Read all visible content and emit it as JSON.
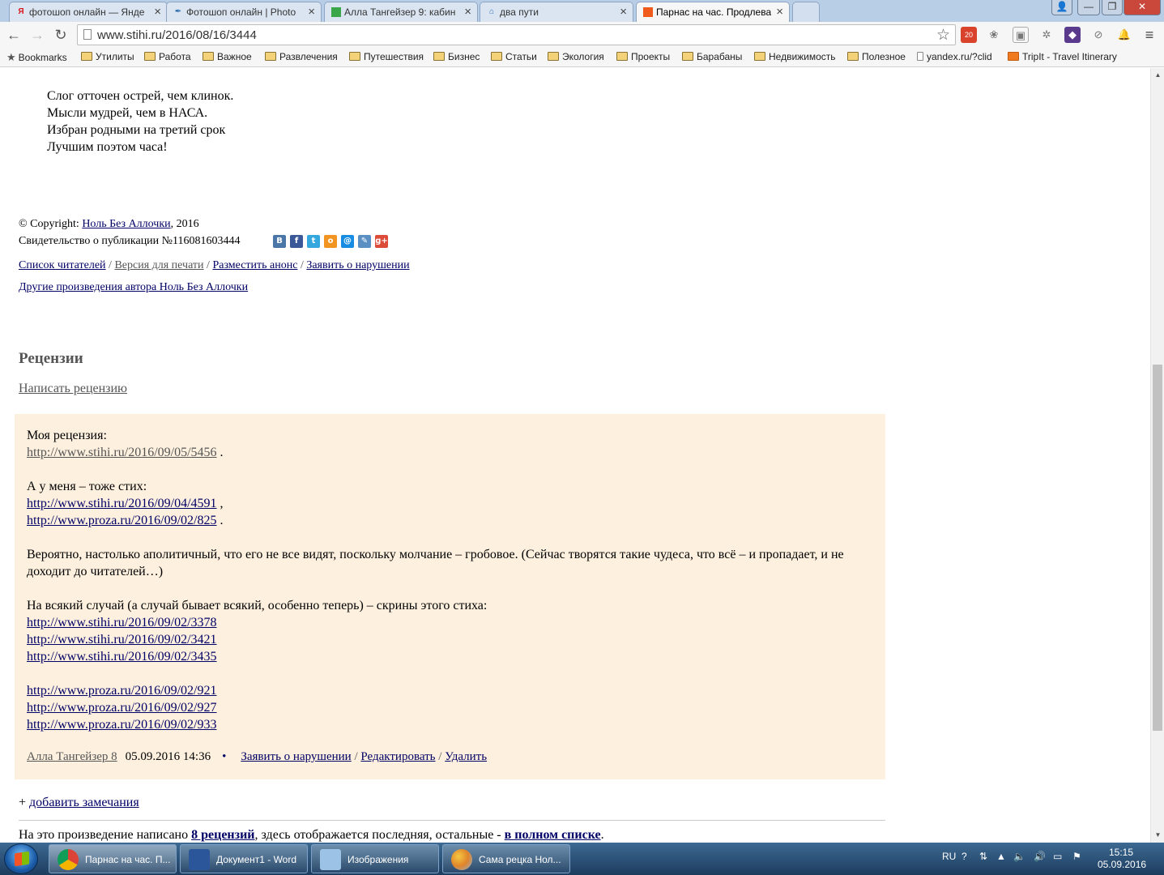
{
  "browser": {
    "tabs": [
      {
        "title": "фотошоп онлайн — Янде",
        "icon": "yandex-icon",
        "color": "#d9141b",
        "active": false
      },
      {
        "title": "Фотошоп онлайн | Photo",
        "icon": "feather-icon",
        "color": "#2b6cb0",
        "active": false
      },
      {
        "title": "Алла Тангейзер 9: кабин",
        "icon": "square-icon",
        "color": "#3aa64a",
        "active": false
      },
      {
        "title": "два пути",
        "icon": "home-icon",
        "color": "#3070b8",
        "active": false
      },
      {
        "title": "Парнас на час. Продлева",
        "icon": "stihi-icon",
        "color": "#f05a1a",
        "active": true
      }
    ],
    "url": "www.stihi.ru/2016/08/16/3444",
    "bookmarks": [
      {
        "label": "Bookmarks",
        "kind": "star"
      },
      {
        "label": "Утилиты",
        "kind": "folder"
      },
      {
        "label": "Работа",
        "kind": "folder"
      },
      {
        "label": "Важное",
        "kind": "folder"
      },
      {
        "label": "Развлечения",
        "kind": "folder"
      },
      {
        "label": "Путешествия",
        "kind": "folder"
      },
      {
        "label": "Бизнес",
        "kind": "folder"
      },
      {
        "label": "Статьи",
        "kind": "folder"
      },
      {
        "label": "Экология",
        "kind": "folder"
      },
      {
        "label": "Проекты",
        "kind": "folder"
      },
      {
        "label": "Барабаны",
        "kind": "folder"
      },
      {
        "label": "Недвижимость",
        "kind": "folder"
      },
      {
        "label": "Полезное",
        "kind": "folder"
      },
      {
        "label": "yandex.ru/?clid",
        "kind": "page"
      },
      {
        "label": "TripIt - Travel Itinerary",
        "kind": "tripit"
      }
    ],
    "extension_badge": "20"
  },
  "poem": {
    "lines": [
      "Слог отточен острей, чем клинок.",
      "Мысли мудрей, чем в НАСА.",
      "Избран родными на третий срок",
      "Лучшим поэтом часа!"
    ]
  },
  "copyright": {
    "prefix": "© Copyright: ",
    "author": "Ноль Без Аллочки",
    "year": ", 2016",
    "certificate": "Свидетельство о публикации №116081603444"
  },
  "share_icons": [
    {
      "name": "vk-share-icon",
      "glyph": "B",
      "color": "#4a76a8"
    },
    {
      "name": "facebook-share-icon",
      "glyph": "f",
      "color": "#3b5998"
    },
    {
      "name": "twitter-share-icon",
      "glyph": "t",
      "color": "#35a7df"
    },
    {
      "name": "odnoklassniki-share-icon",
      "glyph": "o",
      "color": "#f19421"
    },
    {
      "name": "mailru-share-icon",
      "glyph": "@",
      "color": "#168de2"
    },
    {
      "name": "livejournal-share-icon",
      "glyph": "✎",
      "color": "#5a8fc4"
    },
    {
      "name": "googleplus-share-icon",
      "glyph": "g+",
      "color": "#dd4b39"
    }
  ],
  "actions": {
    "readers": "Список читателей",
    "print": "Версия для печати",
    "announce": "Разместить анонс",
    "report": "Заявить о нарушении",
    "other_works": "Другие произведения автора Ноль Без Аллочки"
  },
  "reviews": {
    "heading": "Рецензии",
    "write": "Написать рецензию",
    "review": {
      "intro": "Моя рецензия:",
      "my_link": "http://www.stihi.ru/2016/09/05/5456",
      "also": "А у меня – тоже стих:",
      "also_links": [
        "http://www.stihi.ru/2016/09/04/4591",
        "http://www.proza.ru/2016/09/02/825"
      ],
      "text": "Вероятно, настолько аполитичный, что его не все видят, поскольку молчание – гробовое. (Сейчас творятся такие чудеса, что всё – и пропадает, и не доходит до читателей…)",
      "screens_intro": "На всякий случай (а случай бывает всякий, особенно теперь) – скрины этого стиха:",
      "stihi_screens": [
        "http://www.stihi.ru/2016/09/02/3378",
        "http://www.stihi.ru/2016/09/02/3421",
        "http://www.stihi.ru/2016/09/02/3435"
      ],
      "proza_screens": [
        "http://www.proza.ru/2016/09/02/921",
        "http://www.proza.ru/2016/09/02/927",
        "http://www.proza.ru/2016/09/02/933"
      ],
      "author": "Алла Тангейзер 8",
      "date": "05.09.2016 14:36",
      "report": "Заявить о нарушении",
      "edit": "Редактировать",
      "delete": "Удалить"
    },
    "add_notes": "добавить замечания",
    "summary_prefix": "На это произведение написано ",
    "count": "8 рецензий",
    "summary_middle": ", здесь отображается последняя, остальные - ",
    "full_list": "в полном списке",
    "summary_end": "."
  },
  "taskbar": {
    "tasks": [
      {
        "label": "Парнас на час. П...",
        "icon": "chrome-icon",
        "active": true
      },
      {
        "label": "Документ1 - Word",
        "icon": "word-icon",
        "active": false
      },
      {
        "label": "Изображения",
        "icon": "explorer-icon",
        "active": false
      },
      {
        "label": "Сама рецка Нол...",
        "icon": "paint-icon",
        "active": false
      }
    ],
    "language": "RU",
    "time": "15:15",
    "date": "05.09.2016"
  },
  "colors": {
    "link": "#000066",
    "review_background": "#fdf0de",
    "heading": "#555555"
  }
}
